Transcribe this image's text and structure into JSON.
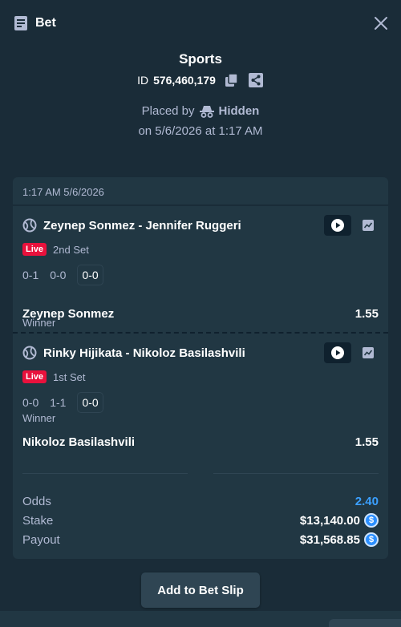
{
  "header": {
    "title": "Bet",
    "icon": "bet-slip-icon",
    "close_icon": "close-icon"
  },
  "summary": {
    "sport": "Sports",
    "id_label": "ID",
    "id_value": "576,460,179",
    "placed_by_label": "Placed by",
    "placed_by_name": "Hidden",
    "placed_on": "on 5/6/2026 at 1:17 AM"
  },
  "card": {
    "timestamp": "1:17 AM 5/6/2026",
    "legs": [
      {
        "match": "Zeynep Sonmez - Jennifer Ruggeri",
        "live_label": "Live",
        "period": "2nd Set",
        "scores": [
          "0-1",
          "0-0",
          "0-0"
        ],
        "market": "Winner",
        "selection": "Zeynep Sonmez",
        "odds": "1.55"
      },
      {
        "match": "Rinky Hijikata - Nikoloz Basilashvili",
        "live_label": "Live",
        "period": "1st Set",
        "scores": [
          "0-0",
          "1-1",
          "0-0"
        ],
        "market": "Winner",
        "selection": "Nikoloz Basilashvili",
        "odds": "1.55"
      }
    ],
    "totals": {
      "odds_label": "Odds",
      "odds_value": "2.40",
      "stake_label": "Stake",
      "stake_value": "$13,140.00",
      "payout_label": "Payout",
      "payout_value": "$31,568.85"
    }
  },
  "actions": {
    "add_to_slip": "Add to Bet Slip"
  },
  "colors": {
    "bg": "#1a2c38",
    "card": "#213743",
    "live": "#e9113c",
    "odds": "#3ba0ff"
  }
}
